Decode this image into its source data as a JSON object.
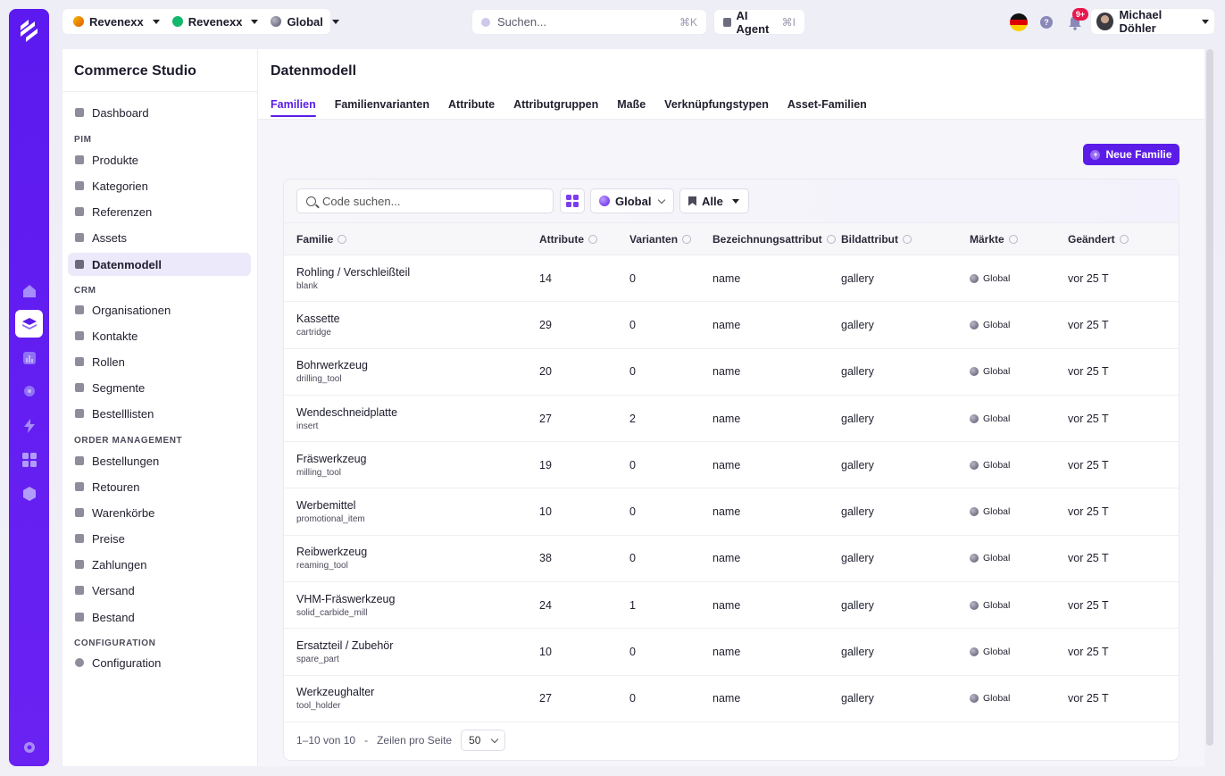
{
  "topbar": {
    "org": "Revenexx",
    "channel": "Revenexx",
    "market": "Global",
    "search": {
      "placeholder": "Suchen...",
      "shortcut": "⌘K"
    },
    "ai": {
      "label": "AI Agent",
      "shortcut": "⌘I"
    },
    "notifications_badge": "9+",
    "user_name": "Michael Döhler"
  },
  "sidebar": {
    "title": "Commerce Studio",
    "dashboard": "Dashboard",
    "sections": {
      "pim": "PIM",
      "crm": "CRM",
      "order": "ORDER MANAGEMENT",
      "config": "CONFIGURATION"
    },
    "pim_items": [
      "Produkte",
      "Kategorien",
      "Referenzen",
      "Assets",
      "Datenmodell"
    ],
    "crm_items": [
      "Organisationen",
      "Kontakte",
      "Rollen",
      "Segmente",
      "Bestelllisten"
    ],
    "order_items": [
      "Bestellungen",
      "Retouren",
      "Warenkörbe",
      "Preise",
      "Zahlungen",
      "Versand",
      "Bestand"
    ],
    "config_items": [
      "Configuration"
    ]
  },
  "main": {
    "title": "Datenmodell",
    "tabs": [
      "Familien",
      "Familienvarianten",
      "Attribute",
      "Attributgruppen",
      "Maße",
      "Verknüpfungstypen",
      "Asset-Familien"
    ],
    "new_button": "Neue Familie",
    "filters": {
      "search_placeholder": "Code suchen...",
      "market": "Global",
      "status": "Alle"
    },
    "table": {
      "headers": [
        "Familie",
        "Attribute",
        "Varianten",
        "Bezeichnungsattribut",
        "Bildattribut",
        "Märkte",
        "Geändert"
      ],
      "rows": [
        {
          "name": "Rohling / Verschleißteil",
          "code": "blank",
          "attributes": "14",
          "variants": "0",
          "label_attr": "name",
          "image_attr": "gallery",
          "market": "Global",
          "changed": "vor 25 T"
        },
        {
          "name": "Kassette",
          "code": "cartridge",
          "attributes": "29",
          "variants": "0",
          "label_attr": "name",
          "image_attr": "gallery",
          "market": "Global",
          "changed": "vor 25 T"
        },
        {
          "name": "Bohrwerkzeug",
          "code": "drilling_tool",
          "attributes": "20",
          "variants": "0",
          "label_attr": "name",
          "image_attr": "gallery",
          "market": "Global",
          "changed": "vor 25 T"
        },
        {
          "name": "Wendeschneidplatte",
          "code": "insert",
          "attributes": "27",
          "variants": "2",
          "label_attr": "name",
          "image_attr": "gallery",
          "market": "Global",
          "changed": "vor 25 T"
        },
        {
          "name": "Fräswerkzeug",
          "code": "milling_tool",
          "attributes": "19",
          "variants": "0",
          "label_attr": "name",
          "image_attr": "gallery",
          "market": "Global",
          "changed": "vor 25 T"
        },
        {
          "name": "Werbemittel",
          "code": "promotional_item",
          "attributes": "10",
          "variants": "0",
          "label_attr": "name",
          "image_attr": "gallery",
          "market": "Global",
          "changed": "vor 25 T"
        },
        {
          "name": "Reibwerkzeug",
          "code": "reaming_tool",
          "attributes": "38",
          "variants": "0",
          "label_attr": "name",
          "image_attr": "gallery",
          "market": "Global",
          "changed": "vor 25 T"
        },
        {
          "name": "VHM-Fräswerkzeug",
          "code": "solid_carbide_mill",
          "attributes": "24",
          "variants": "1",
          "label_attr": "name",
          "image_attr": "gallery",
          "market": "Global",
          "changed": "vor 25 T"
        },
        {
          "name": "Ersatzteil / Zubehör",
          "code": "spare_part",
          "attributes": "10",
          "variants": "0",
          "label_attr": "name",
          "image_attr": "gallery",
          "market": "Global",
          "changed": "vor 25 T"
        },
        {
          "name": "Werkzeughalter",
          "code": "tool_holder",
          "attributes": "27",
          "variants": "0",
          "label_attr": "name",
          "image_attr": "gallery",
          "market": "Global",
          "changed": "vor 25 T"
        }
      ]
    },
    "pagination": {
      "range": "1–10 von 10",
      "separator": "-",
      "rows_label": "Zeilen pro Seite",
      "rows_value": "50"
    }
  },
  "colors": {
    "accent": "#5b1ce8",
    "rail": "#6a22f2",
    "badge": "#e8174b"
  }
}
